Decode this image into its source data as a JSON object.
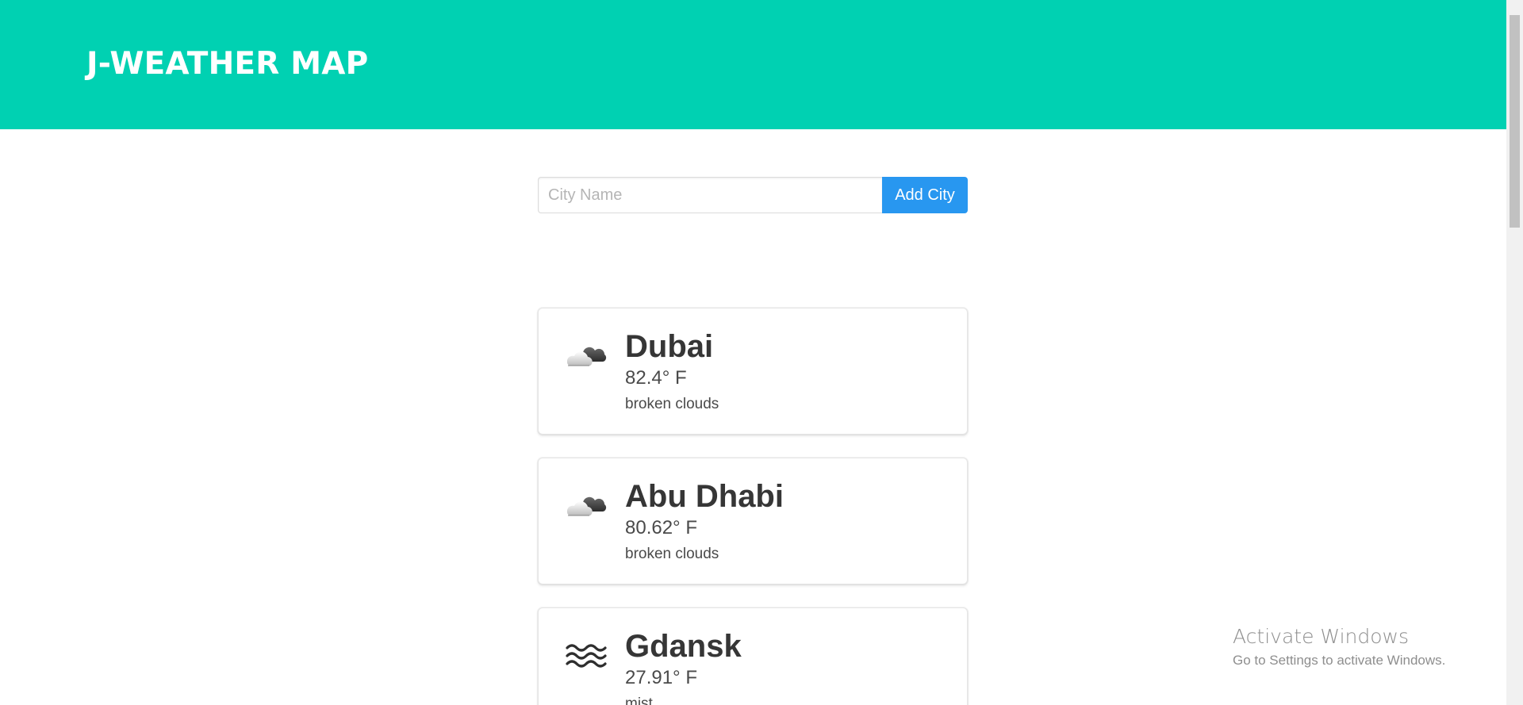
{
  "header": {
    "title": "J-WEATHER MAP",
    "background": "#00d1b2"
  },
  "form": {
    "placeholder": "City Name",
    "value": "",
    "button_label": "Add City",
    "button_color": "#2897f0"
  },
  "cities": [
    {
      "name": "Dubai",
      "temperature": "82.4° F",
      "description": "broken clouds",
      "icon": "broken-clouds-icon"
    },
    {
      "name": "Abu Dhabi",
      "temperature": "80.62° F",
      "description": "broken clouds",
      "icon": "broken-clouds-icon"
    },
    {
      "name": "Gdansk",
      "temperature": "27.91° F",
      "description": "mist",
      "icon": "mist-icon"
    }
  ],
  "watermark": {
    "title": "Activate Windows",
    "subtitle": "Go to Settings to activate Windows."
  }
}
